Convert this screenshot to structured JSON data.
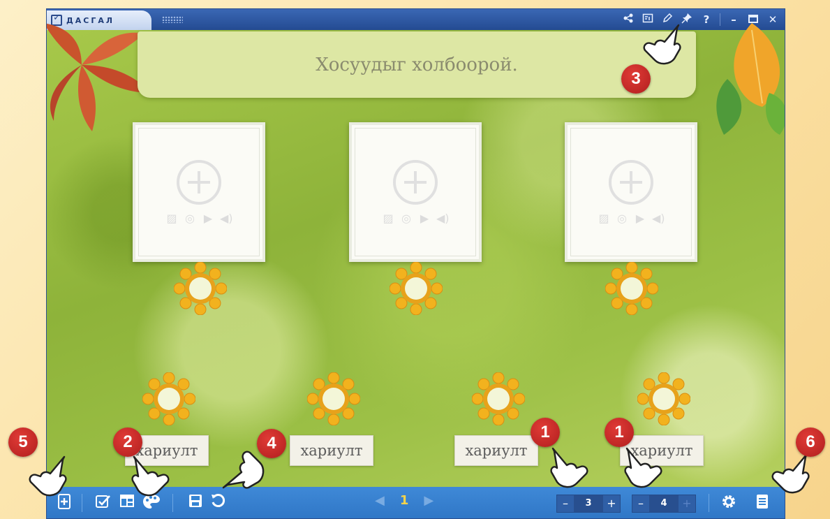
{
  "app": {
    "title": "ДАСГАЛ"
  },
  "titlebar": {
    "icons": [
      "share-icon",
      "layout-icon",
      "pencil-icon",
      "pin-icon",
      "help-icon",
      "minimize-icon",
      "maximize-icon",
      "close-icon"
    ],
    "help_label": "?",
    "minimize_label": "–",
    "close_label": "✕"
  },
  "banner": {
    "text": "Хосуудыг холбоорой."
  },
  "cards": [
    {
      "media": [
        "image-icon",
        "video-reel-icon",
        "youtube-icon",
        "audio-icon"
      ]
    },
    {
      "media": [
        "image-icon",
        "video-reel-icon",
        "youtube-icon",
        "audio-icon"
      ]
    },
    {
      "media": [
        "image-icon",
        "video-reel-icon",
        "youtube-icon",
        "audio-icon"
      ]
    }
  ],
  "answers": [
    {
      "label": "хариулт"
    },
    {
      "label": "хариулт"
    },
    {
      "label": "хариулт"
    },
    {
      "label": "хариулт"
    }
  ],
  "toolbar": {
    "page": "1",
    "stepper_left": {
      "minus": "–",
      "value": "3",
      "plus": "+"
    },
    "stepper_right": {
      "minus": "–",
      "value": "4",
      "plus": "+"
    }
  },
  "annotations": {
    "badge_1a": "1",
    "badge_1b": "1",
    "badge_2": "2",
    "badge_3": "3",
    "badge_4": "4",
    "badge_5": "5",
    "badge_6": "6"
  },
  "colors": {
    "toolbar": "#3a84d3",
    "titlebar": "#2d56a0",
    "badge": "#c5282a",
    "page_number": "#f7d34a"
  }
}
